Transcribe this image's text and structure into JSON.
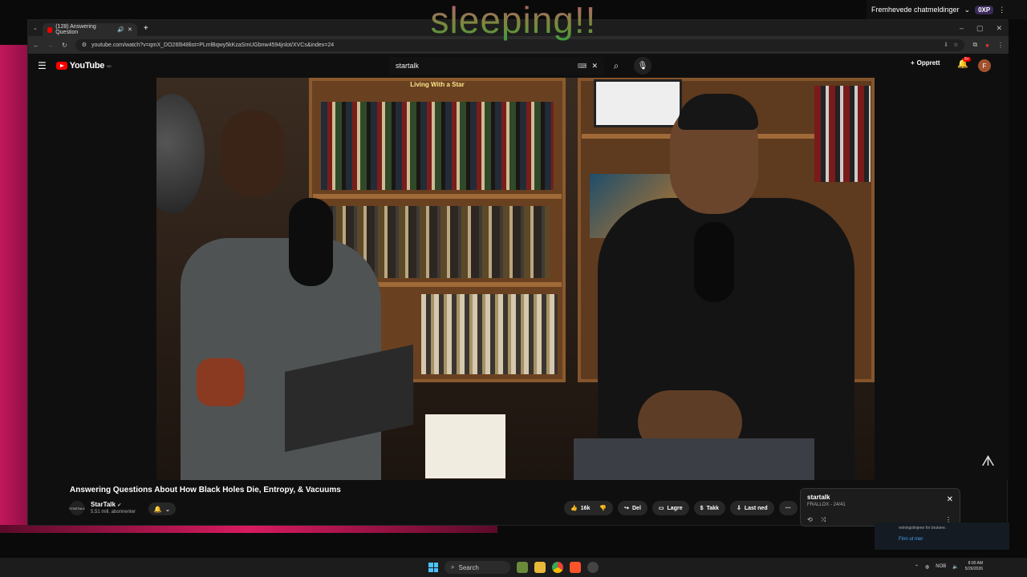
{
  "overlay": {
    "text": "sleeping!!"
  },
  "stream_chat": {
    "label": "Fremhevede chatmeldinger",
    "badge": "0XP"
  },
  "browser": {
    "tab_title": "(128) Answering Question",
    "url": "youtube.com/watch?v=qmX_DO26l948list=PLmlBqwy5kKzaSmUGbnw4594jnlot/XVCs&index=24"
  },
  "youtube": {
    "logo_text": "YouTube",
    "logo_sup": "NO",
    "search_value": "startalk",
    "create_label": "Opprett",
    "notification_count": "9+",
    "avatar_letter": "F"
  },
  "video": {
    "title": "Answering Questions About How Black Holes Die, Entropy, & Vacuums",
    "channel": "StarTalk",
    "channel_logo_text": "STARTALK",
    "subscribers": "5,51 mill. abonnenter",
    "likes": "16k",
    "share_label": "Del",
    "save_label": "Lagre",
    "thanks_label": "Takk",
    "download_label": "Last ned",
    "overlay_mark": "ᗑ",
    "bookshelf_text": "Living With a Star"
  },
  "playlist": {
    "title": "startalk",
    "subtitle": "FRALLOX - 24/41"
  },
  "promo": {
    "text": "retningslinjene for brukere.",
    "link": "Finn ut mer"
  },
  "taskbar": {
    "search_label": "Search",
    "lang": "NOB",
    "time": "8:00 AM",
    "date": "5/26/2026"
  },
  "colors": {
    "youtube_red": "#ff0000",
    "accent_blue": "#3ea6ff",
    "stream_pink": "#d81b60"
  }
}
